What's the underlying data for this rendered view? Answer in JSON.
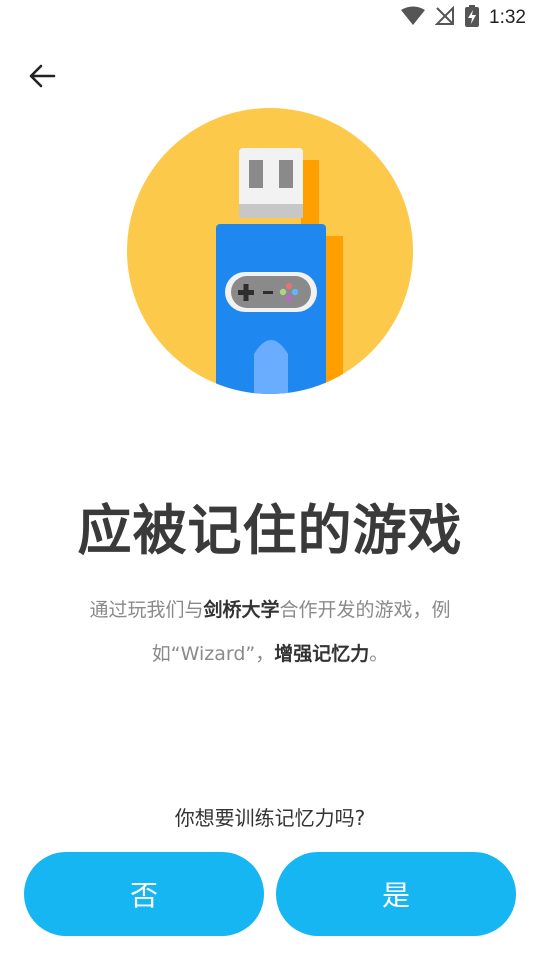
{
  "status_bar": {
    "time": "1:32"
  },
  "icons": {
    "back": "arrow-left-icon",
    "wifi": "wifi-icon",
    "signal": "no-signal-icon",
    "battery": "battery-charging-icon",
    "hero": "usb-game-controller-illustration"
  },
  "main": {
    "title": "应被记住的游戏",
    "description": {
      "part1": "通过玩我们与",
      "bold1": "剑桥大学",
      "part2": "合作开发的游戏，例如“Wizard”，",
      "bold2": "增强记忆力",
      "part3": "。"
    },
    "question": "你想要训练记忆力吗?"
  },
  "buttons": {
    "no_label": "否",
    "yes_label": "是"
  },
  "colors": {
    "accent": "#16b6f3",
    "hero_circle": "#fdc94a",
    "usb_body": "#1e88f0",
    "usb_shadow": "#ffa000"
  }
}
